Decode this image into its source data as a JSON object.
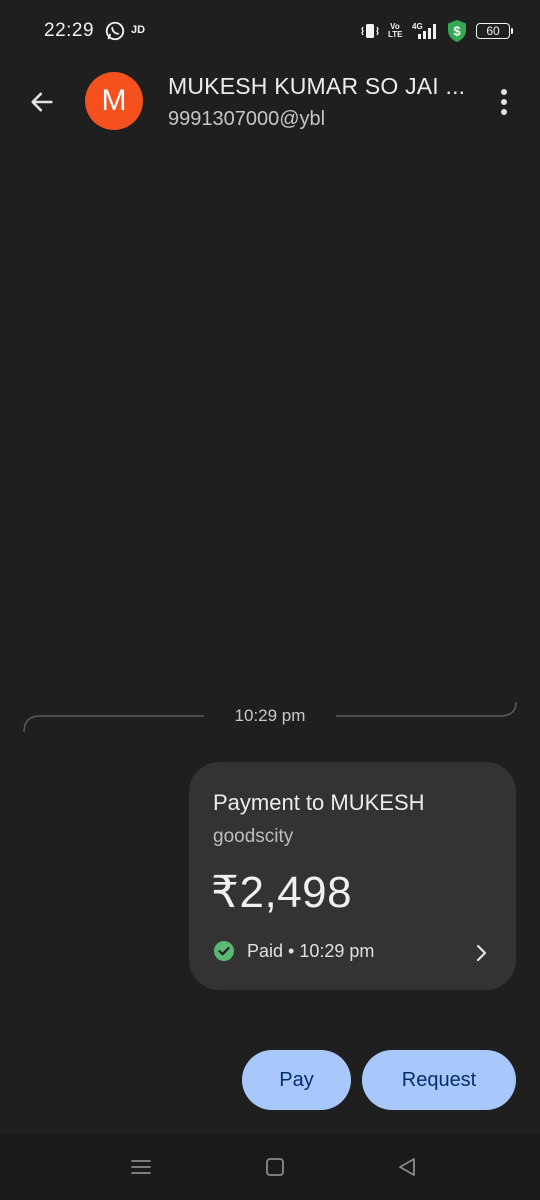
{
  "status_bar": {
    "time": "22:29",
    "app_badge": "JD",
    "volte": "Vo\nLTE",
    "network": "4G",
    "battery": "60",
    "icons": [
      "whatsapp-icon",
      "vibrate-icon",
      "signal-icon",
      "shield-dollar-icon",
      "battery-icon"
    ]
  },
  "header": {
    "avatar_initial": "M",
    "contact_name": "MUKESH KUMAR SO JAI ...",
    "upi_id": "9991307000@ybl",
    "icons": [
      "back-arrow-icon",
      "more-vert-icon"
    ]
  },
  "conversation": {
    "timestamp": "10:29 pm",
    "payment": {
      "title": "Payment to MUKESH",
      "note": "goodscity",
      "amount": "₹2,498",
      "status": "Paid • 10:29 pm",
      "status_color": "#5bb974"
    }
  },
  "actions": {
    "pay_label": "Pay",
    "request_label": "Request",
    "button_color": "#a8c7fa"
  },
  "nav": {
    "icons": [
      "recents-menu-icon",
      "home-square-icon",
      "back-triangle-icon"
    ]
  }
}
